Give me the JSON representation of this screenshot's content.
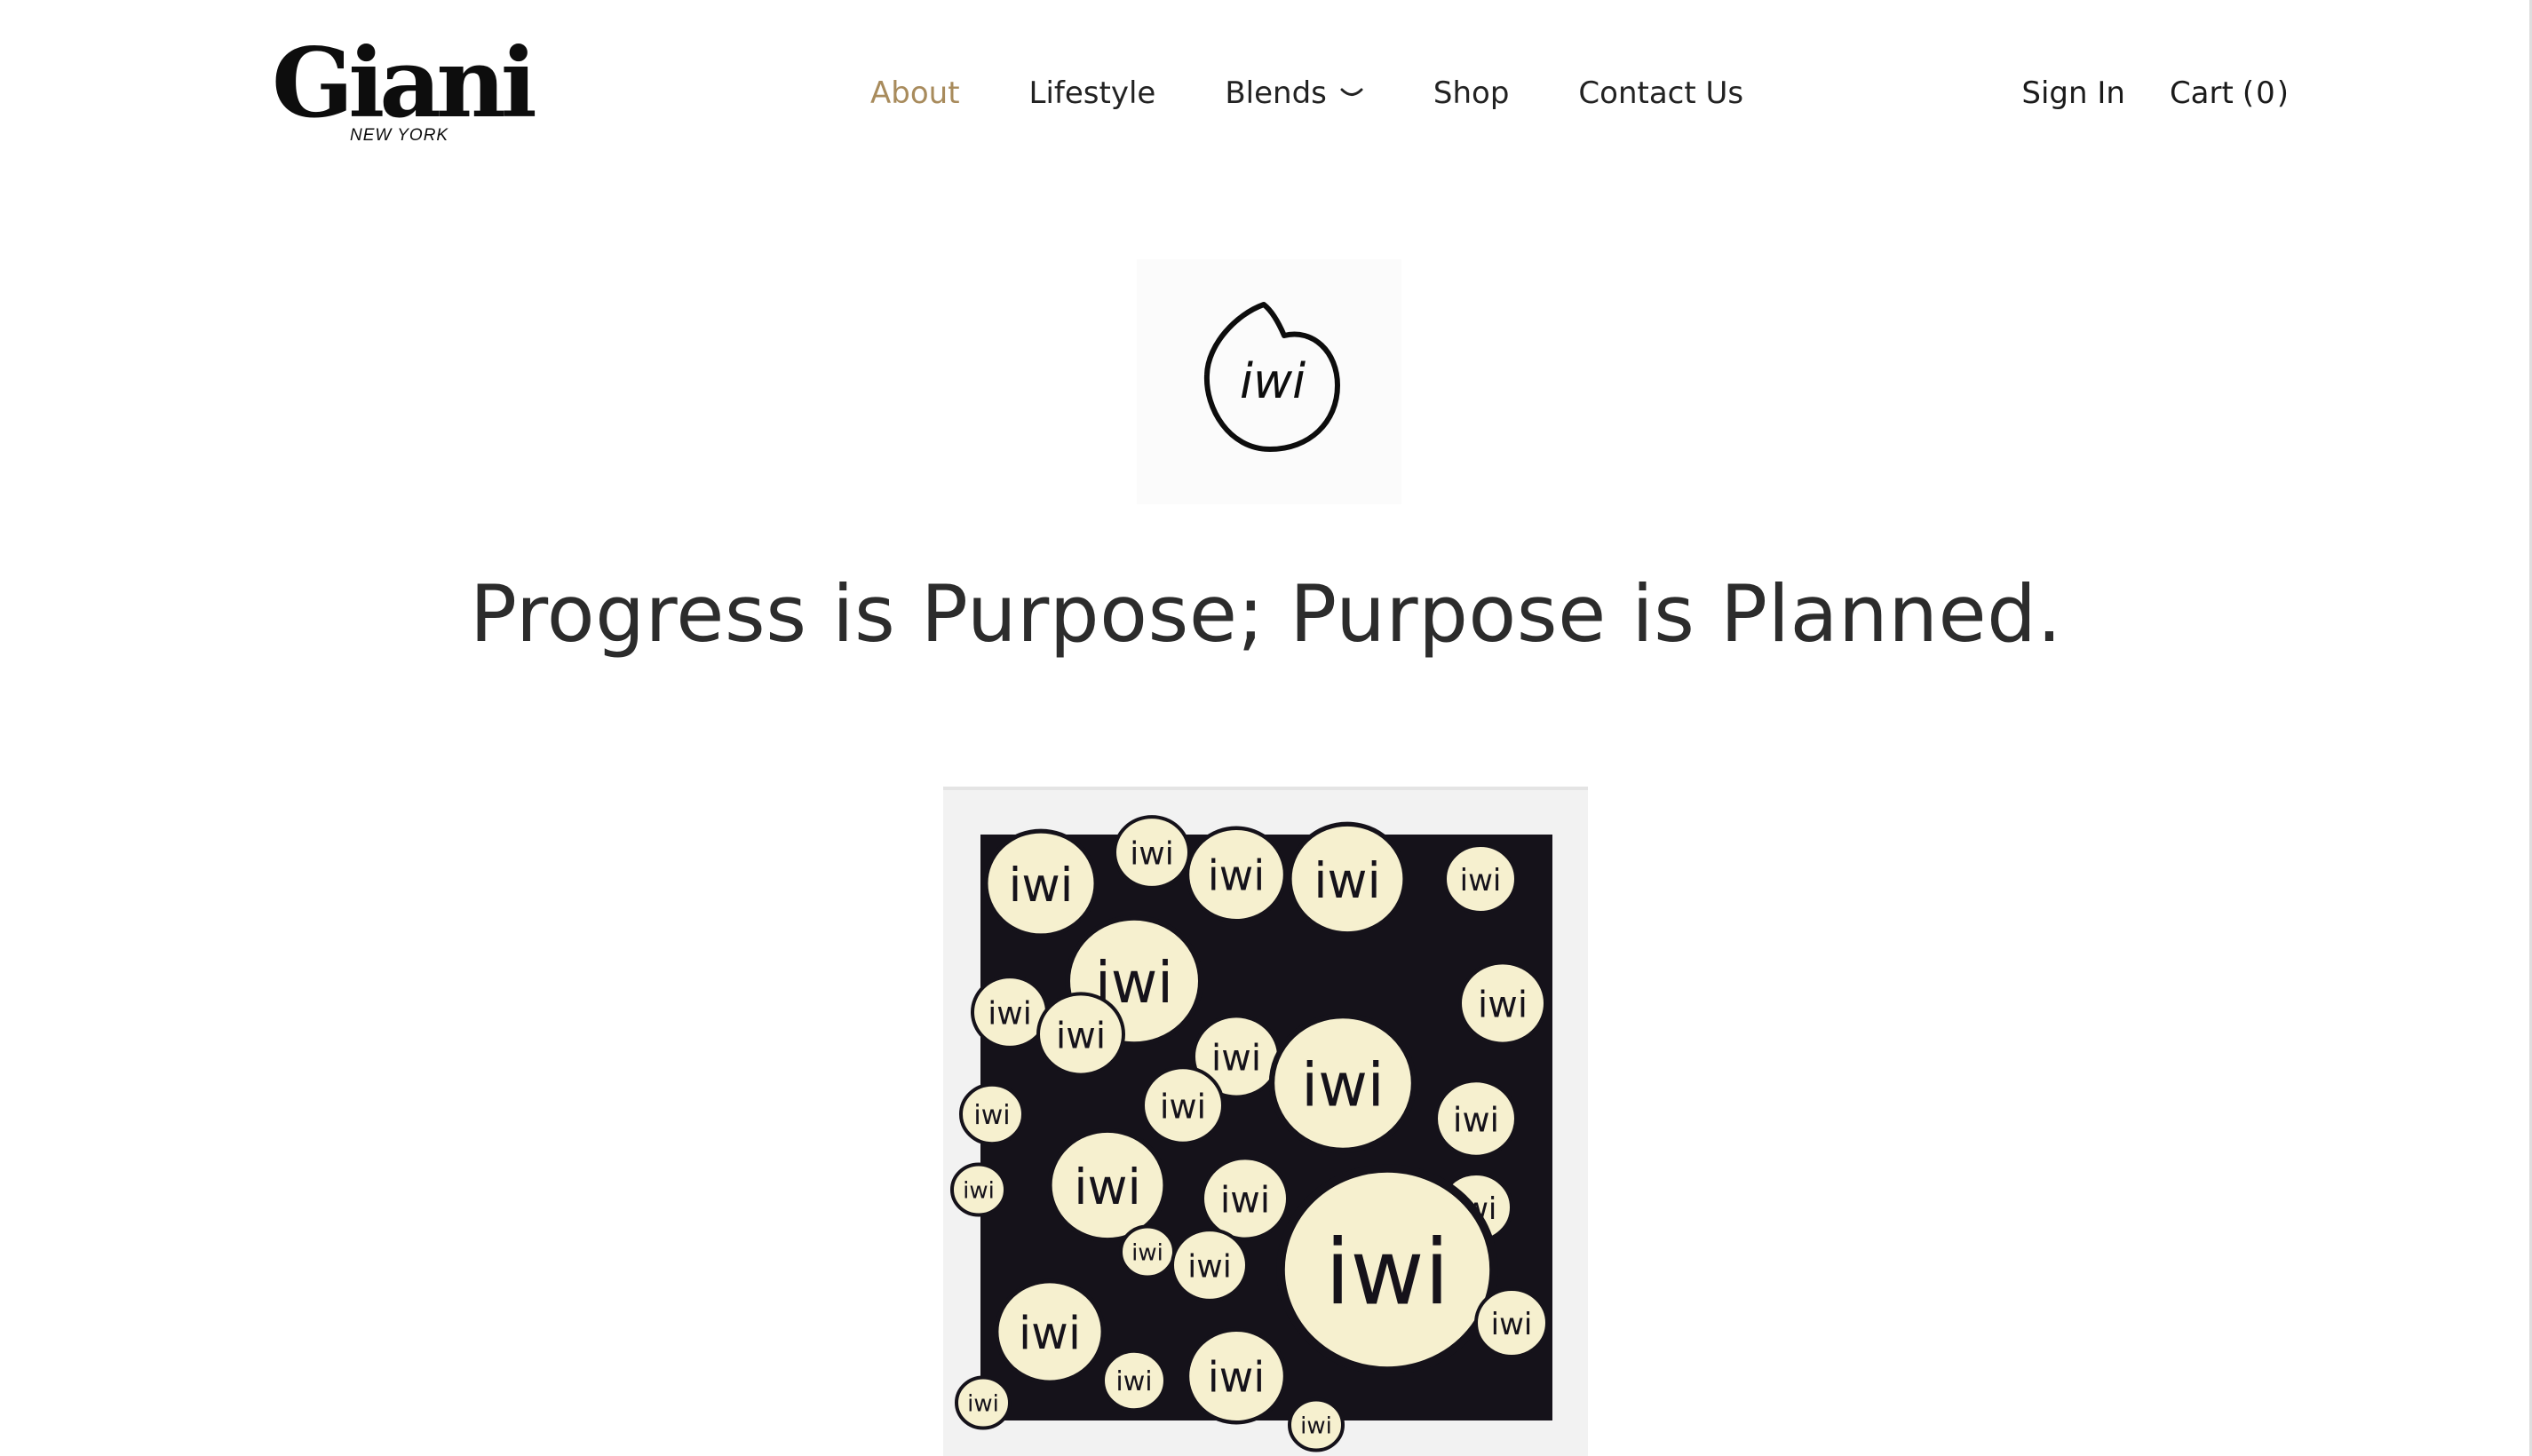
{
  "brand": {
    "logo_text": "Giani",
    "logo_subtext": "NEW YORK"
  },
  "nav": {
    "items": [
      {
        "label": "About",
        "active": true
      },
      {
        "label": "Lifestyle",
        "active": false
      },
      {
        "label": "Blends",
        "active": false,
        "has_dropdown": true
      },
      {
        "label": "Shop",
        "active": false
      },
      {
        "label": "Contact Us",
        "active": false
      }
    ],
    "dropdown_icon": "chevron-down-icon"
  },
  "account": {
    "sign_in": "Sign In",
    "cart_label": "Cart",
    "cart_count": "(0)"
  },
  "emblem": {
    "icon": "iwi-face-emblem-icon",
    "mark_text": "iwi"
  },
  "headline": "Progress is Purpose; Purpose is Planned.",
  "artwork": {
    "icon": "iwi-faces-artwork-image",
    "mark_text": "iwi"
  },
  "colors": {
    "accent": "#a88b5c",
    "text": "#222222",
    "headline": "#2c2c2c",
    "art_background": "#15121a",
    "art_faces": "#f6f0cf"
  }
}
